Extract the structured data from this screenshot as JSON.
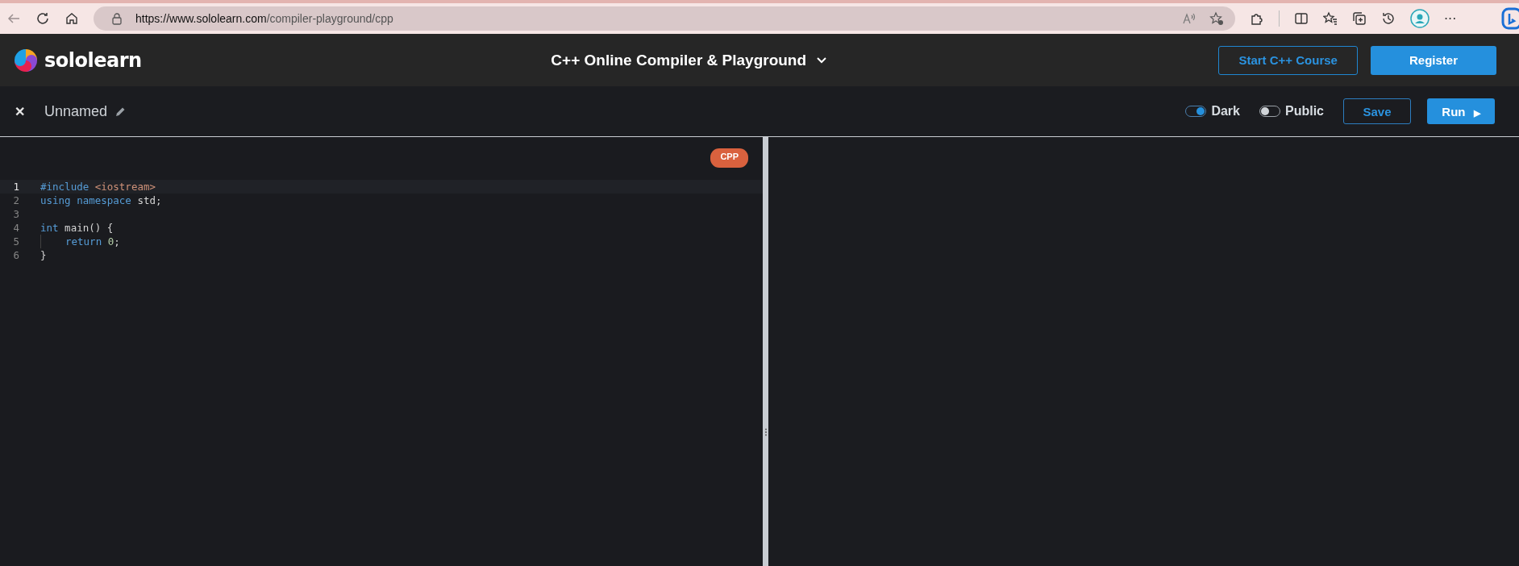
{
  "browser": {
    "url_host": "https://www.sololearn.com",
    "url_path": "/compiler-playground/cpp",
    "more": "···"
  },
  "header": {
    "logo": "sololearn",
    "title": "C++ Online Compiler & Playground",
    "buttons": [
      {
        "label": "Start C++ Course",
        "kind": "outline"
      },
      {
        "label": "Register",
        "kind": "filled"
      }
    ]
  },
  "toolbar": {
    "close": "✕",
    "file_name": "Unnamed",
    "toggles": [
      {
        "label": "Dark",
        "on": true
      },
      {
        "label": "Public",
        "on": false
      }
    ],
    "save": "Save",
    "run": "Run",
    "run_icon": "▶"
  },
  "editor": {
    "language": "CPP",
    "lines": [
      {
        "number": "1",
        "active": true,
        "indent": false,
        "tokens": [
          {
            "text": "#include",
            "kind": "keyword"
          },
          {
            "text": " <iostream>",
            "kind": "string"
          }
        ]
      },
      {
        "number": "2",
        "active": false,
        "indent": false,
        "tokens": [
          {
            "text": "using",
            "kind": "keyword"
          },
          {
            "text": " namespace",
            "kind": "keyword"
          },
          {
            "text": " std;",
            "kind": "plain"
          }
        ]
      },
      {
        "number": "3",
        "active": false,
        "indent": false
      },
      {
        "number": "4",
        "active": false,
        "indent": false,
        "tokens": [
          {
            "text": "int",
            "kind": "keyword"
          },
          {
            "text": " main() {",
            "kind": "plain"
          }
        ]
      },
      {
        "number": "5",
        "active": false,
        "indent": true,
        "tokens": [
          {
            "text": "return",
            "kind": "keyword"
          },
          {
            "text": " 0",
            "kind": "number"
          },
          {
            "text": ";",
            "kind": "plain"
          }
        ]
      },
      {
        "number": "6",
        "active": false,
        "indent": false,
        "tokens": [
          {
            "text": "}",
            "kind": "plain"
          }
        ]
      }
    ]
  }
}
